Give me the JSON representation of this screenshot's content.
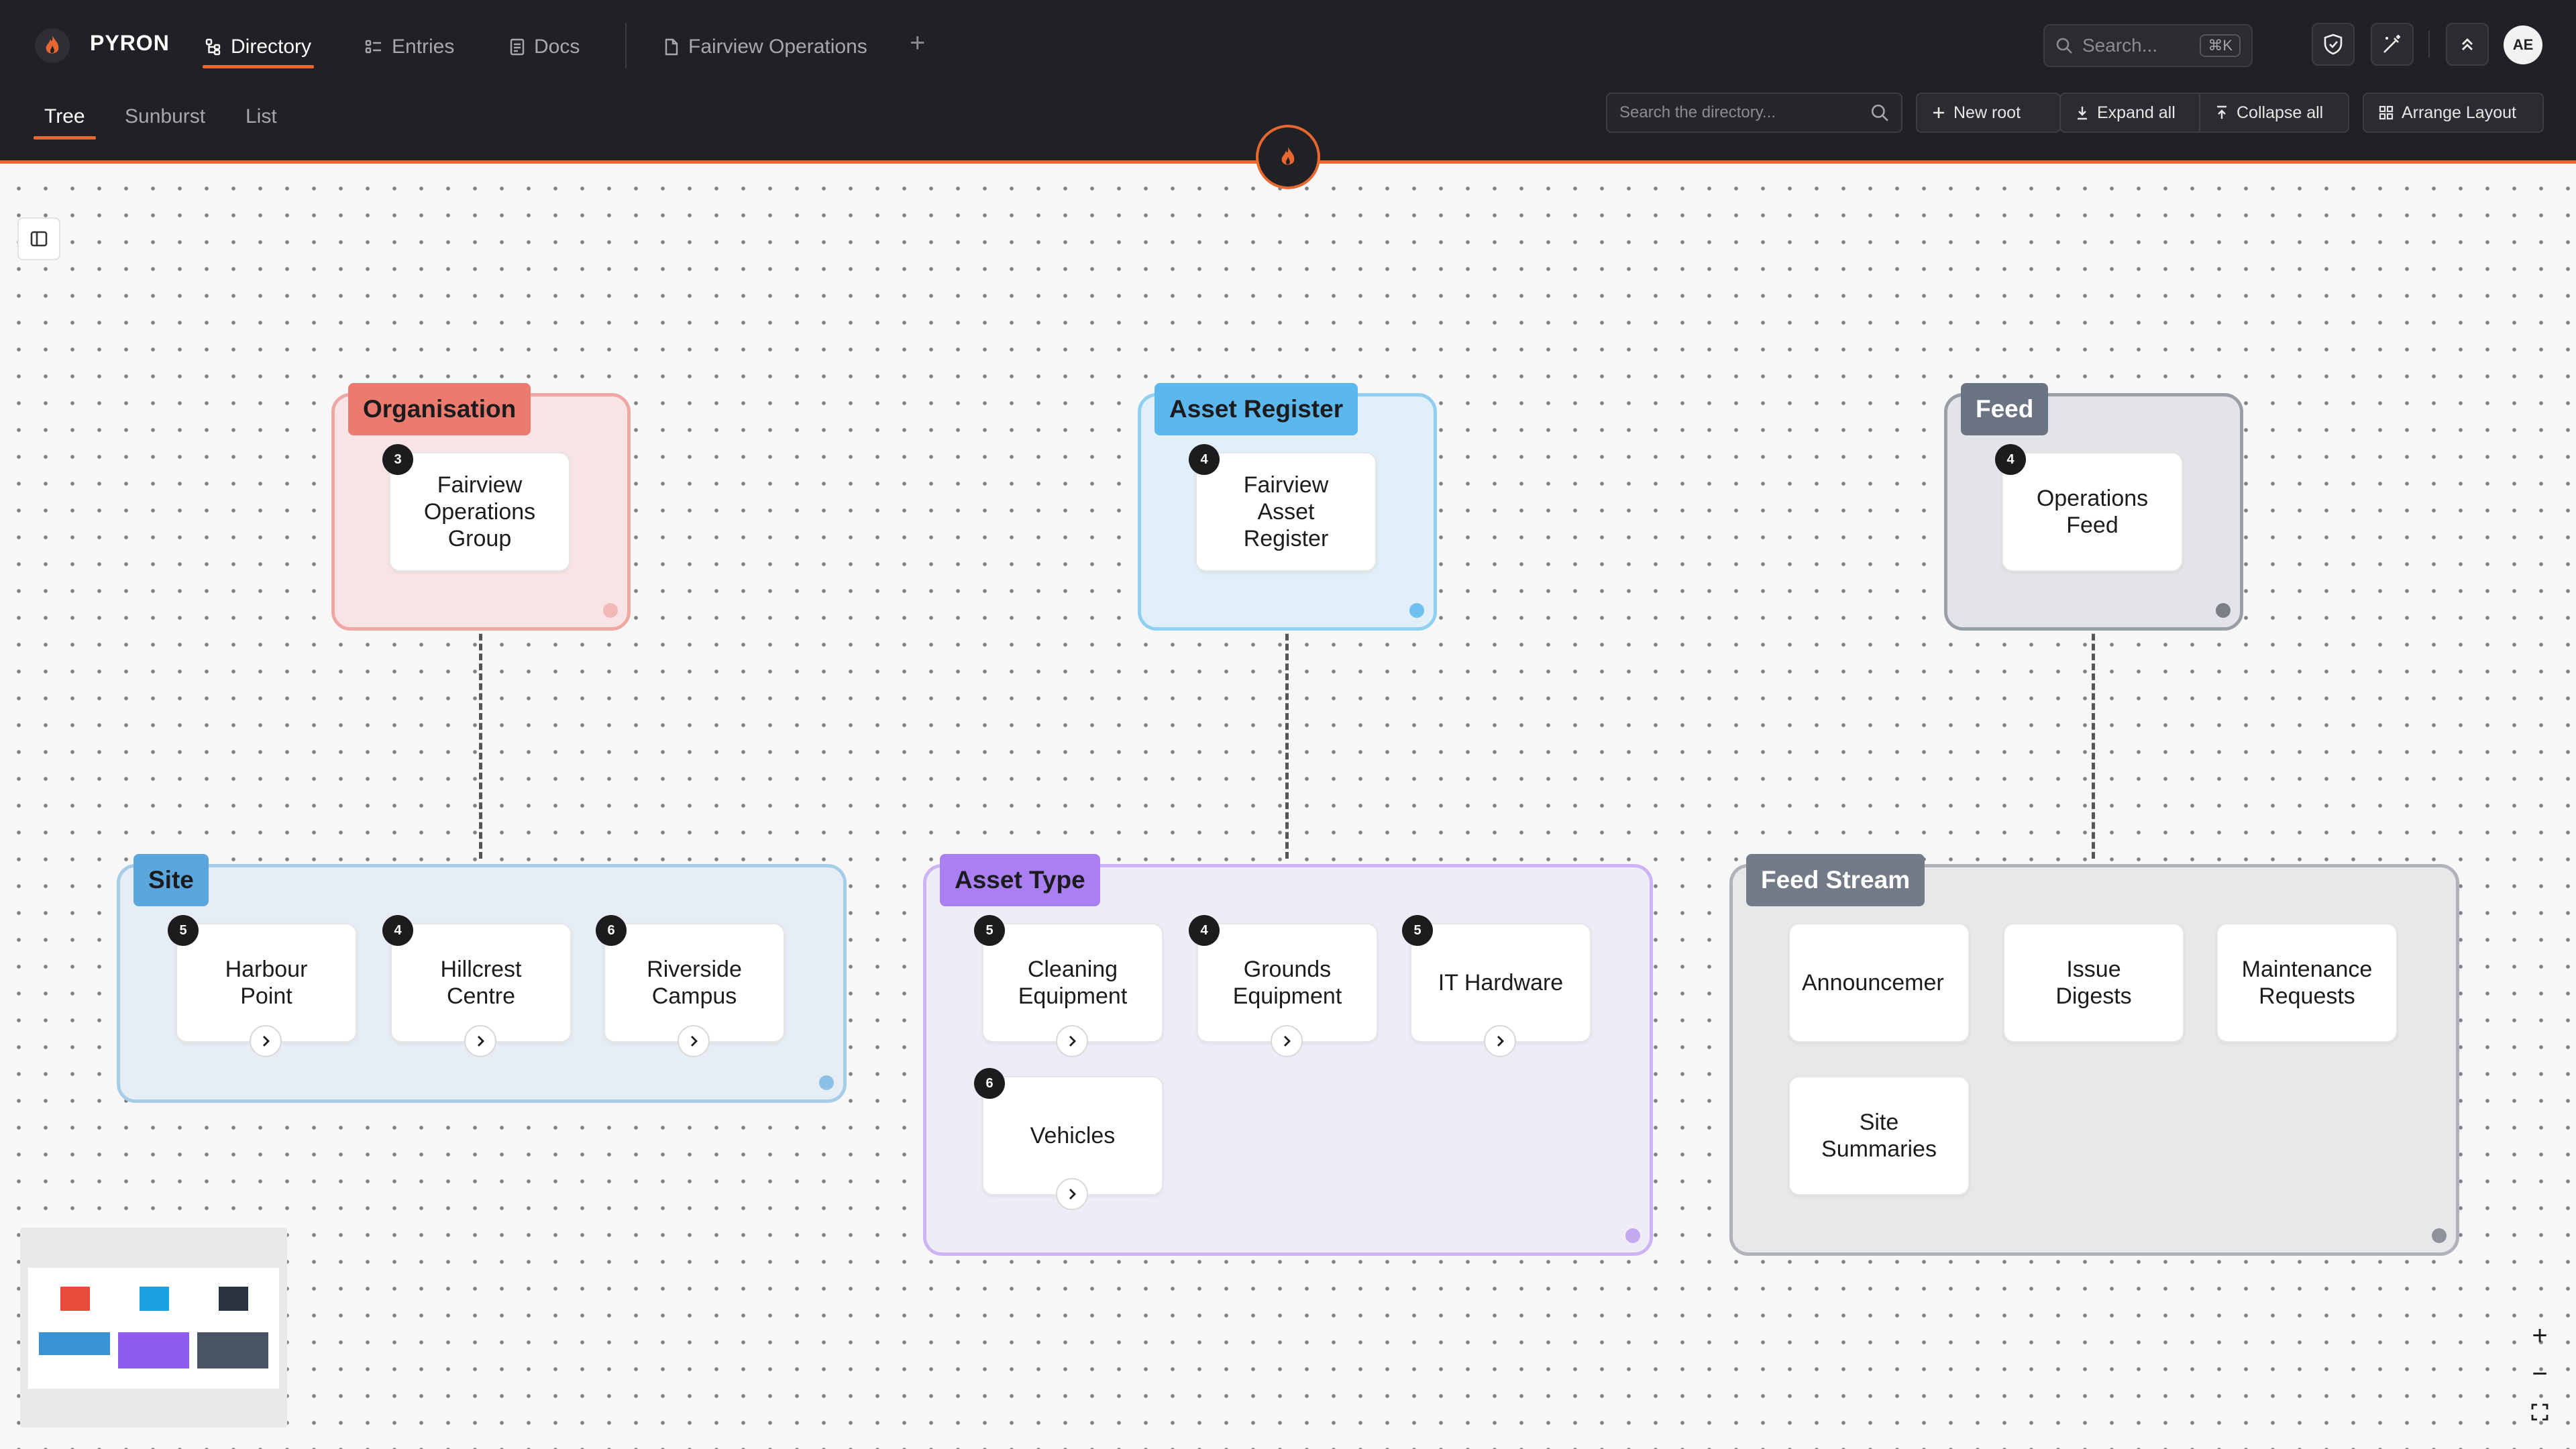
{
  "app": {
    "brand": "PYRON"
  },
  "nav": {
    "directory": "Directory",
    "entries": "Entries",
    "docs": "Docs",
    "open_doc": "Fairview Operations",
    "add_tab": "+"
  },
  "search": {
    "placeholder": "Search...",
    "shortcut": "⌘K"
  },
  "user": {
    "initials": "AE"
  },
  "views": {
    "tree": "Tree",
    "sunburst": "Sunburst",
    "list": "List"
  },
  "toolbar": {
    "directory_search_placeholder": "Search the directory...",
    "new_root": "New root",
    "expand_all": "Expand all",
    "collapse_all": "Collapse all",
    "arrange_layout": "Arrange Layout"
  },
  "colors": {
    "accent": "#e8662f",
    "organisation": "#ec7b6f",
    "asset_register": "#5bb7ec",
    "feed": "#6a7382",
    "site": "#5ba6dc",
    "asset_type": "#a97ff2",
    "feed_stream": "#737b88"
  },
  "groups": {
    "organisation": {
      "label": "Organisation",
      "nodes": [
        {
          "name": "Fairview\nOperations\nGroup",
          "count": "3"
        }
      ]
    },
    "asset_register": {
      "label": "Asset Register",
      "nodes": [
        {
          "name": "Fairview\nAsset\nRegister",
          "count": "4"
        }
      ]
    },
    "feed": {
      "label": "Feed",
      "nodes": [
        {
          "name": "Operations\nFeed",
          "count": "4"
        }
      ]
    },
    "site": {
      "label": "Site",
      "nodes": [
        {
          "name": "Harbour\nPoint",
          "count": "5"
        },
        {
          "name": "Hillcrest\nCentre",
          "count": "4"
        },
        {
          "name": "Riverside\nCampus",
          "count": "6"
        }
      ]
    },
    "asset_type": {
      "label": "Asset Type",
      "nodes": [
        {
          "name": "Cleaning\nEquipment",
          "count": "5"
        },
        {
          "name": "Grounds\nEquipment",
          "count": "4"
        },
        {
          "name": "IT Hardware",
          "count": "5"
        },
        {
          "name": "Vehicles",
          "count": "6"
        }
      ]
    },
    "feed_stream": {
      "label": "Feed Stream",
      "nodes": [
        {
          "name": "Announcemer"
        },
        {
          "name": "Issue\nDigests"
        },
        {
          "name": "Maintenance\nRequests"
        },
        {
          "name": "Site\nSummaries"
        }
      ]
    }
  },
  "zoom": {
    "in": "+",
    "out": "−"
  }
}
